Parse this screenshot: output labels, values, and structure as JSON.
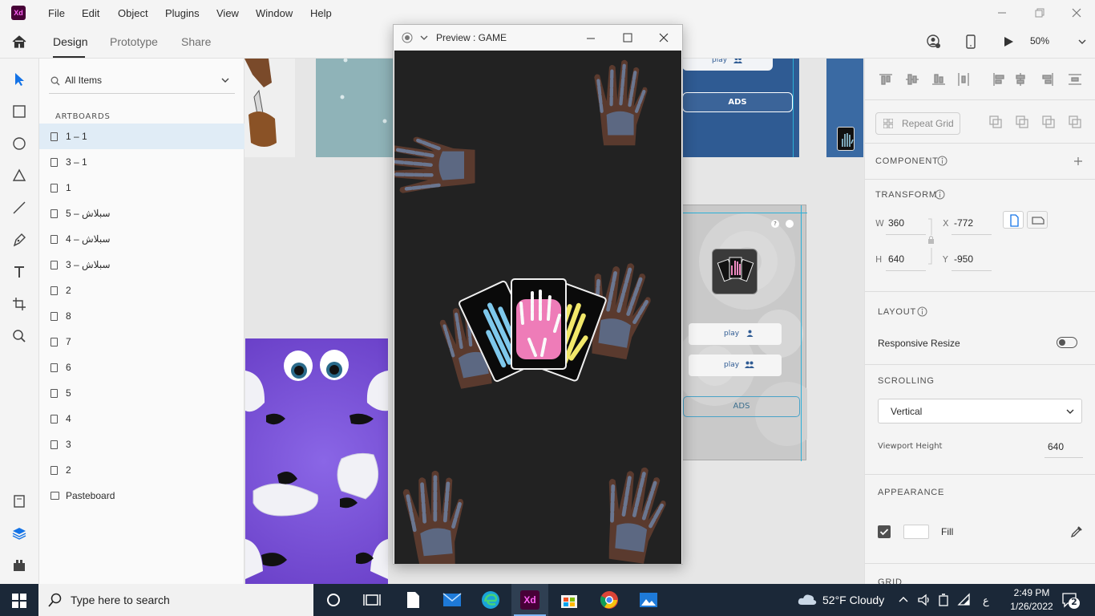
{
  "app": {
    "logo": "Xd"
  },
  "menu": [
    "File",
    "Edit",
    "Object",
    "Plugins",
    "View",
    "Window",
    "Help"
  ],
  "modes": {
    "design": "Design",
    "prototype": "Prototype",
    "share": "Share"
  },
  "toolbar": {
    "zoom": "50%"
  },
  "layers": {
    "search_value": "All Items",
    "section": "ARTBOARDS",
    "items": [
      "1 – 1",
      "3 – 1",
      "1",
      "سبلاش – 5",
      "سبلاش – 4",
      "سبلاش – 3",
      "2",
      "8",
      "7",
      "6",
      "5",
      "4",
      "3",
      "2",
      "Pasteboard"
    ]
  },
  "canvas": {
    "top_button_play": "play",
    "top_button_ads": "ADS",
    "right_artboard": {
      "play_single": "play",
      "play_multi": "play",
      "ads": "ADS"
    }
  },
  "preview": {
    "title": "Preview : GAME"
  },
  "props": {
    "repeat_grid": "Repeat Grid",
    "component_title": "COMPONENT",
    "transform_title": "TRANSFORM",
    "w_label": "W",
    "w_value": "360",
    "h_label": "H",
    "h_value": "640",
    "x_label": "X",
    "x_value": "-772",
    "y_label": "Y",
    "y_value": "-950",
    "layout_title": "LAYOUT",
    "responsive_resize": "Responsive Resize",
    "scrolling_title": "SCROLLING",
    "scrolling_value": "Vertical",
    "viewport_label": "Viewport Height",
    "viewport_value": "640",
    "appearance_title": "APPEARANCE",
    "fill_label": "Fill",
    "grid_title": "GRID"
  },
  "taskbar": {
    "search_placeholder": "Type here to search",
    "weather": "52°F  Cloudy",
    "time": "2:49 PM",
    "date": "1/26/2022",
    "lang": "ع",
    "notification_count": "2"
  },
  "colors": {
    "accent": "#1473e6",
    "xd_brand": "#470137",
    "xd_pink": "#ff61f6",
    "preview_bg": "#222222",
    "purple_artboard": "#7b55d6",
    "blue_artboard": "#2f5b93"
  }
}
